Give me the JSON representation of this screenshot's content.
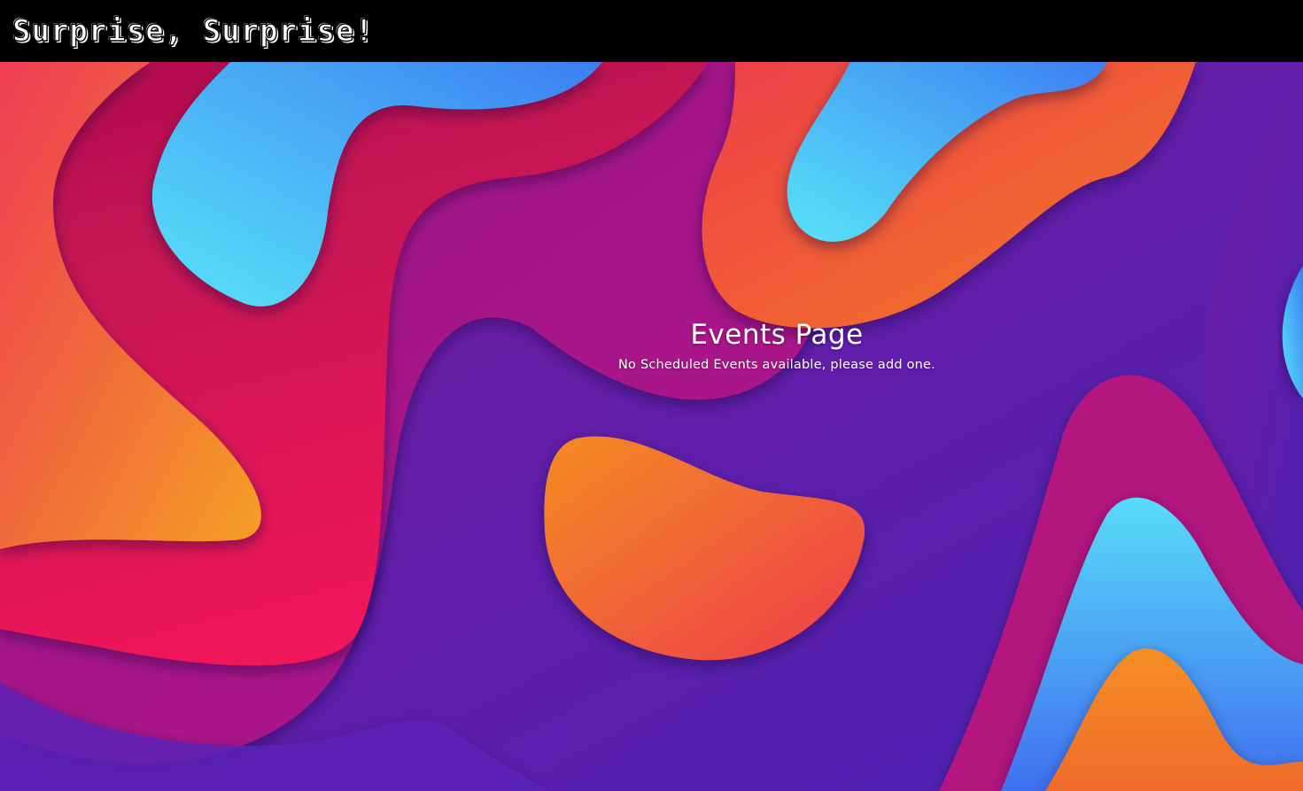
{
  "header": {
    "brand_title": "Surprise, Surprise!"
  },
  "main": {
    "title": "Events Page",
    "message": "No Scheduled Events available, please add one."
  },
  "colors": {
    "header_bg": "#000000",
    "text": "#ffffff",
    "purple": "#6a1fb0",
    "magenta": "#b2177f",
    "red": "#e8175a",
    "orange": "#f28a24",
    "cyan": "#52d8f6",
    "blue": "#3f8cf4"
  }
}
